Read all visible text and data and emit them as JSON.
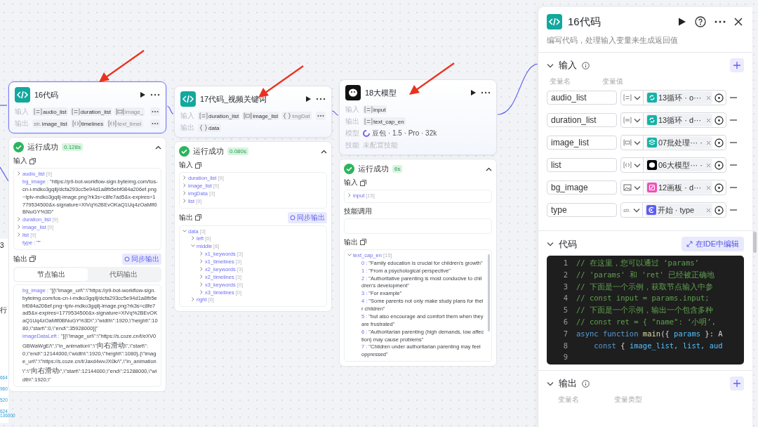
{
  "canvas": {
    "fragment_lines": [
      "3",
      "行",
      "664",
      "960",
      "520",
      "624",
      "136000"
    ]
  },
  "nodes": [
    {
      "title": "16代码",
      "kind": "code",
      "selected": true,
      "rows": [
        {
          "kind": "chips",
          "label": "输入",
          "more": true,
          "chips": [
            {
              "kind": "list",
              "text": "audio_list",
              "faded": false
            },
            {
              "kind": "list",
              "text": "duration_list",
              "faded": false
            },
            {
              "kind": "image-list",
              "text": "image_",
              "faded": true
            }
          ]
        },
        {
          "kind": "chips",
          "label": "输出",
          "more": true,
          "chips": [
            {
              "kind": "string",
              "type_label": "str.",
              "text": "image_list",
              "faded": false
            },
            {
              "kind": "object-list",
              "text": "timelines",
              "faded": false
            },
            {
              "kind": "object-list",
              "text": "text_timel",
              "faded": true
            }
          ]
        }
      ],
      "result": {
        "status": "运行成功",
        "time": "0.128s",
        "sections": [
          {
            "kind": "tree",
            "title": "输入",
            "copy": true,
            "items": [
              {
                "key": "audio_list",
                "count": "[9]",
                "expanded": false
              },
              {
                "key": "bg_image :",
                "value": "\"https://p9-bot-workflow-sign.byteimg.com/tos-cn-i-mdko3gqilj/dcfa293cc5e94d1a8fb5ebf084a206ef.png~tplv-mdko3gqilj-image.png?rk3s=c8fe7ad5&x-expires=1779534500&x-signature=XIVq%2BEvOKaQ1Uq4zOaMlf0BNuGY%3D\""
              },
              {
                "key": "duration_list",
                "count": "[9]",
                "expanded": false
              },
              {
                "key": "image_list",
                "count": "[9]",
                "expanded": false
              },
              {
                "key": "list",
                "count": "[9]",
                "expanded": false
              },
              {
                "key": "type :",
                "value": "\"\""
              }
            ]
          },
          {
            "kind": "tree",
            "title": "输出",
            "copy": true,
            "sync": "同步输出",
            "tabs": [
              {
                "label": "节点输出",
                "selected": true
              },
              {
                "label": "代码输出",
                "selected": false
              }
            ],
            "items": [
              {
                "key": "bg_image :",
                "value": "\"[{\\\"image_url\\\":\\\"https://p9-bot-workflow-sign.byteimg.com/tos-cn-i-mdko3gqilj/dcfa293cc5e94d1a8fb5ebf084a206ef.png~tplv-mdko3gqilj-image.png?rk3s=c8fe7ad5&x-expires=1779534500&x-signature=XIVq%2BEvOKaQ1Uq4zOaMlf0BNuGY%3D\\\",\\\"width\\\":1920,\\\"height\\\":1080,\\\"start\\\":0,\\\"end\\\":35928000}]\""
              },
              {
                "key": "imageDataLeft :",
                "value": "\"[{\\\"image_url\\\":\\\"https://s.coze.cn/t/eXV0GBWaWgE/\\\",\\\"in_animation\\\":\\\"向右滑动\\\",\\\"start\\\":0,\\\"end\\\":12144000,\\\"width\\\":1920,\\\"height\\\":1080},{\\\"image_url\\\":\\\"https://s.coze.cn/t/Jaxd4wvJX0k/\\\",\\\"in_animation\\\":\\\"向右滑动\\\",\\\"start\\\":12144000,\\\"end\\\":21288000,\\\"width\\\":1920,\\\""
              }
            ]
          }
        ]
      }
    },
    {
      "title": "17代码_视频关键词",
      "kind": "code",
      "selected": false,
      "rows": [
        {
          "kind": "chips",
          "label": "输入",
          "more": true,
          "chips": [
            {
              "kind": "list",
              "text": "duration_list",
              "faded": false
            },
            {
              "kind": "image-list",
              "text": "image_list",
              "faded": false
            },
            {
              "kind": "object",
              "text": "imgDat",
              "faded": true
            }
          ]
        },
        {
          "kind": "chips",
          "label": "输出",
          "more": false,
          "chips": [
            {
              "kind": "object",
              "text": "data",
              "faded": false
            }
          ]
        }
      ],
      "result": {
        "status": "运行成功",
        "time": "0.080s",
        "sections": [
          {
            "kind": "tree",
            "title": "输入",
            "copy": true,
            "items": [
              {
                "key": "duration_list",
                "count": "[9]",
                "expanded": false
              },
              {
                "key": "image_list",
                "count": "[9]",
                "expanded": false
              },
              {
                "key": "imgData",
                "count": "[3]",
                "expanded": false
              },
              {
                "key": "list",
                "count": "[9]",
                "expanded": false
              }
            ]
          },
          {
            "kind": "tree",
            "title": "输出",
            "copy": true,
            "sync": "同步输出",
            "items": [
              {
                "key": "data",
                "count": "[3]",
                "expanded": true,
                "children": [
                  {
                    "key": "left",
                    "count": "[6]",
                    "expanded": false
                  },
                  {
                    "key": "middle",
                    "count": "[6]",
                    "expanded": true,
                    "children": [
                      {
                        "key": "x1_keywords",
                        "count": "[3]",
                        "expanded": false
                      },
                      {
                        "key": "x1_timelines",
                        "count": "[3]",
                        "expanded": false
                      },
                      {
                        "key": "x2_keywords",
                        "count": "[3]",
                        "expanded": false
                      },
                      {
                        "key": "x2_timelines",
                        "count": "[3]",
                        "expanded": false
                      },
                      {
                        "key": "x3_keywords",
                        "count": "[0]",
                        "expanded": false
                      },
                      {
                        "key": "x3_timelines",
                        "count": "[0]",
                        "expanded": false
                      }
                    ]
                  },
                  {
                    "key": "right",
                    "count": "[6]",
                    "expanded": false
                  }
                ]
              }
            ]
          }
        ]
      }
    },
    {
      "title": "18大模型",
      "kind": "llm",
      "selected": false,
      "rows": [
        {
          "kind": "chips",
          "label": "输入",
          "more": false,
          "chips": [
            {
              "kind": "list",
              "text": "input",
              "faded": false
            }
          ]
        },
        {
          "kind": "chips",
          "label": "输出",
          "more": false,
          "chips": [
            {
              "kind": "list",
              "text": "text_cap_en",
              "faded": false
            }
          ]
        },
        {
          "kind": "model",
          "label": "模型",
          "text": "豆包 · 1.5 · Pro · 32k"
        },
        {
          "kind": "plain",
          "label": "技能",
          "text": "未配置技能"
        }
      ],
      "result": {
        "status": "运行成功",
        "time": "6s",
        "sections": [
          {
            "kind": "tree",
            "title": "输入",
            "copy": true,
            "items": [
              {
                "key": "input",
                "count": "[15]",
                "expanded": false
              }
            ]
          },
          {
            "kind": "empty",
            "title": "技能调用",
            "copy": false
          },
          {
            "kind": "tree",
            "title": "输出",
            "copy": true,
            "scroll": true,
            "items": [
              {
                "key": "text_cap_en",
                "count": "[15]",
                "expanded": true,
                "children": [
                  {
                    "key": "0 :",
                    "value": "\"Family education is crucial for children's growth\""
                  },
                  {
                    "key": "1 :",
                    "value": "\"From a psychological perspective\""
                  },
                  {
                    "key": "2 :",
                    "value": "\"Authoritative parenting is most conducive to children's development\""
                  },
                  {
                    "key": "3 :",
                    "value": "\"For example\""
                  },
                  {
                    "key": "4 :",
                    "value": "\"Some parents not only make study plans for their children\""
                  },
                  {
                    "key": "5 :",
                    "value": "\"but also encourage and comfort them when they are frustrated\""
                  },
                  {
                    "key": "6 :",
                    "value": "\"Authoritarian parenting (high demands, low affection) may cause problems\""
                  },
                  {
                    "key": "7 :",
                    "value": "\"Children under authoritarian parenting may feel oppressed\""
                  }
                ]
              }
            ]
          }
        ]
      }
    }
  ],
  "panel": {
    "title": "16代码",
    "description": "编写代码，处理输入变量来生成返回值",
    "input": {
      "title": "输入",
      "columns": [
        "变量名",
        "变量值"
      ],
      "rows": [
        {
          "name": "audio_list",
          "kind": "list-str",
          "ref": {
            "kind": "loop",
            "color": "#14b3a7",
            "text": "13循环 · o···"
          }
        },
        {
          "name": "duration_list",
          "kind": "list-int",
          "ref": {
            "kind": "loop",
            "color": "#14b3a7",
            "text": "13循环 · d···"
          }
        },
        {
          "name": "image_list",
          "kind": "list-image",
          "ref": {
            "kind": "batch",
            "color": "#14b3a7",
            "text": "07批处理··· ·"
          }
        },
        {
          "name": "list",
          "kind": "list-object",
          "ref": {
            "kind": "llm",
            "color": "#000000",
            "text": "06大模型··· ·"
          }
        },
        {
          "name": "bg_image",
          "kind": "image",
          "ref": {
            "kind": "canvas",
            "color": "#f04fb5",
            "text": "12画板 · d···"
          }
        },
        {
          "name": "type",
          "kind": "string",
          "type_label": "str.",
          "ref": {
            "kind": "start",
            "color": "#5d5cf2",
            "text": "开始 · type"
          }
        }
      ]
    },
    "code": {
      "title": "代码",
      "button": "在IDE中编辑",
      "lines": [
        {
          "number": "1",
          "tokens": [
            {
              "kind": "comment",
              "text": "// 在这里，您可以通过 ‘params’"
            }
          ]
        },
        {
          "number": "2",
          "tokens": [
            {
              "kind": "comment",
              "text": "// 'params' 和 'ret' 已经被正确地"
            }
          ]
        },
        {
          "number": "3",
          "tokens": [
            {
              "kind": "comment",
              "text": "// 下面是一个示例，获取节点输入中参"
            }
          ]
        },
        {
          "number": "4",
          "tokens": [
            {
              "kind": "comment",
              "text": "// const input = params.input;"
            }
          ]
        },
        {
          "number": "5",
          "tokens": [
            {
              "kind": "comment",
              "text": "// 下面是一个示例，输出一个包含多种"
            }
          ]
        },
        {
          "number": "6",
          "tokens": [
            {
              "kind": "comment",
              "text": "// const ret = { \"name\": ‘小明’,"
            }
          ]
        },
        {
          "number": "7",
          "tokens": [
            {
              "kind": "keyword",
              "text": "async function "
            },
            {
              "kind": "function",
              "text": "main"
            },
            {
              "kind": "plain",
              "text": "({ "
            },
            {
              "kind": "variable",
              "text": "params"
            },
            {
              "kind": "plain",
              "text": " }: A"
            }
          ]
        },
        {
          "number": "8",
          "tokens": [
            {
              "kind": "keyword",
              "text": "    const"
            },
            {
              "kind": "plain",
              "text": " { "
            },
            {
              "kind": "variable",
              "text": "image_list, list, aud"
            }
          ]
        },
        {
          "number": "9"
        }
      ]
    },
    "output": {
      "title": "输出",
      "columns": [
        "变量名",
        "变量类型"
      ]
    }
  }
}
